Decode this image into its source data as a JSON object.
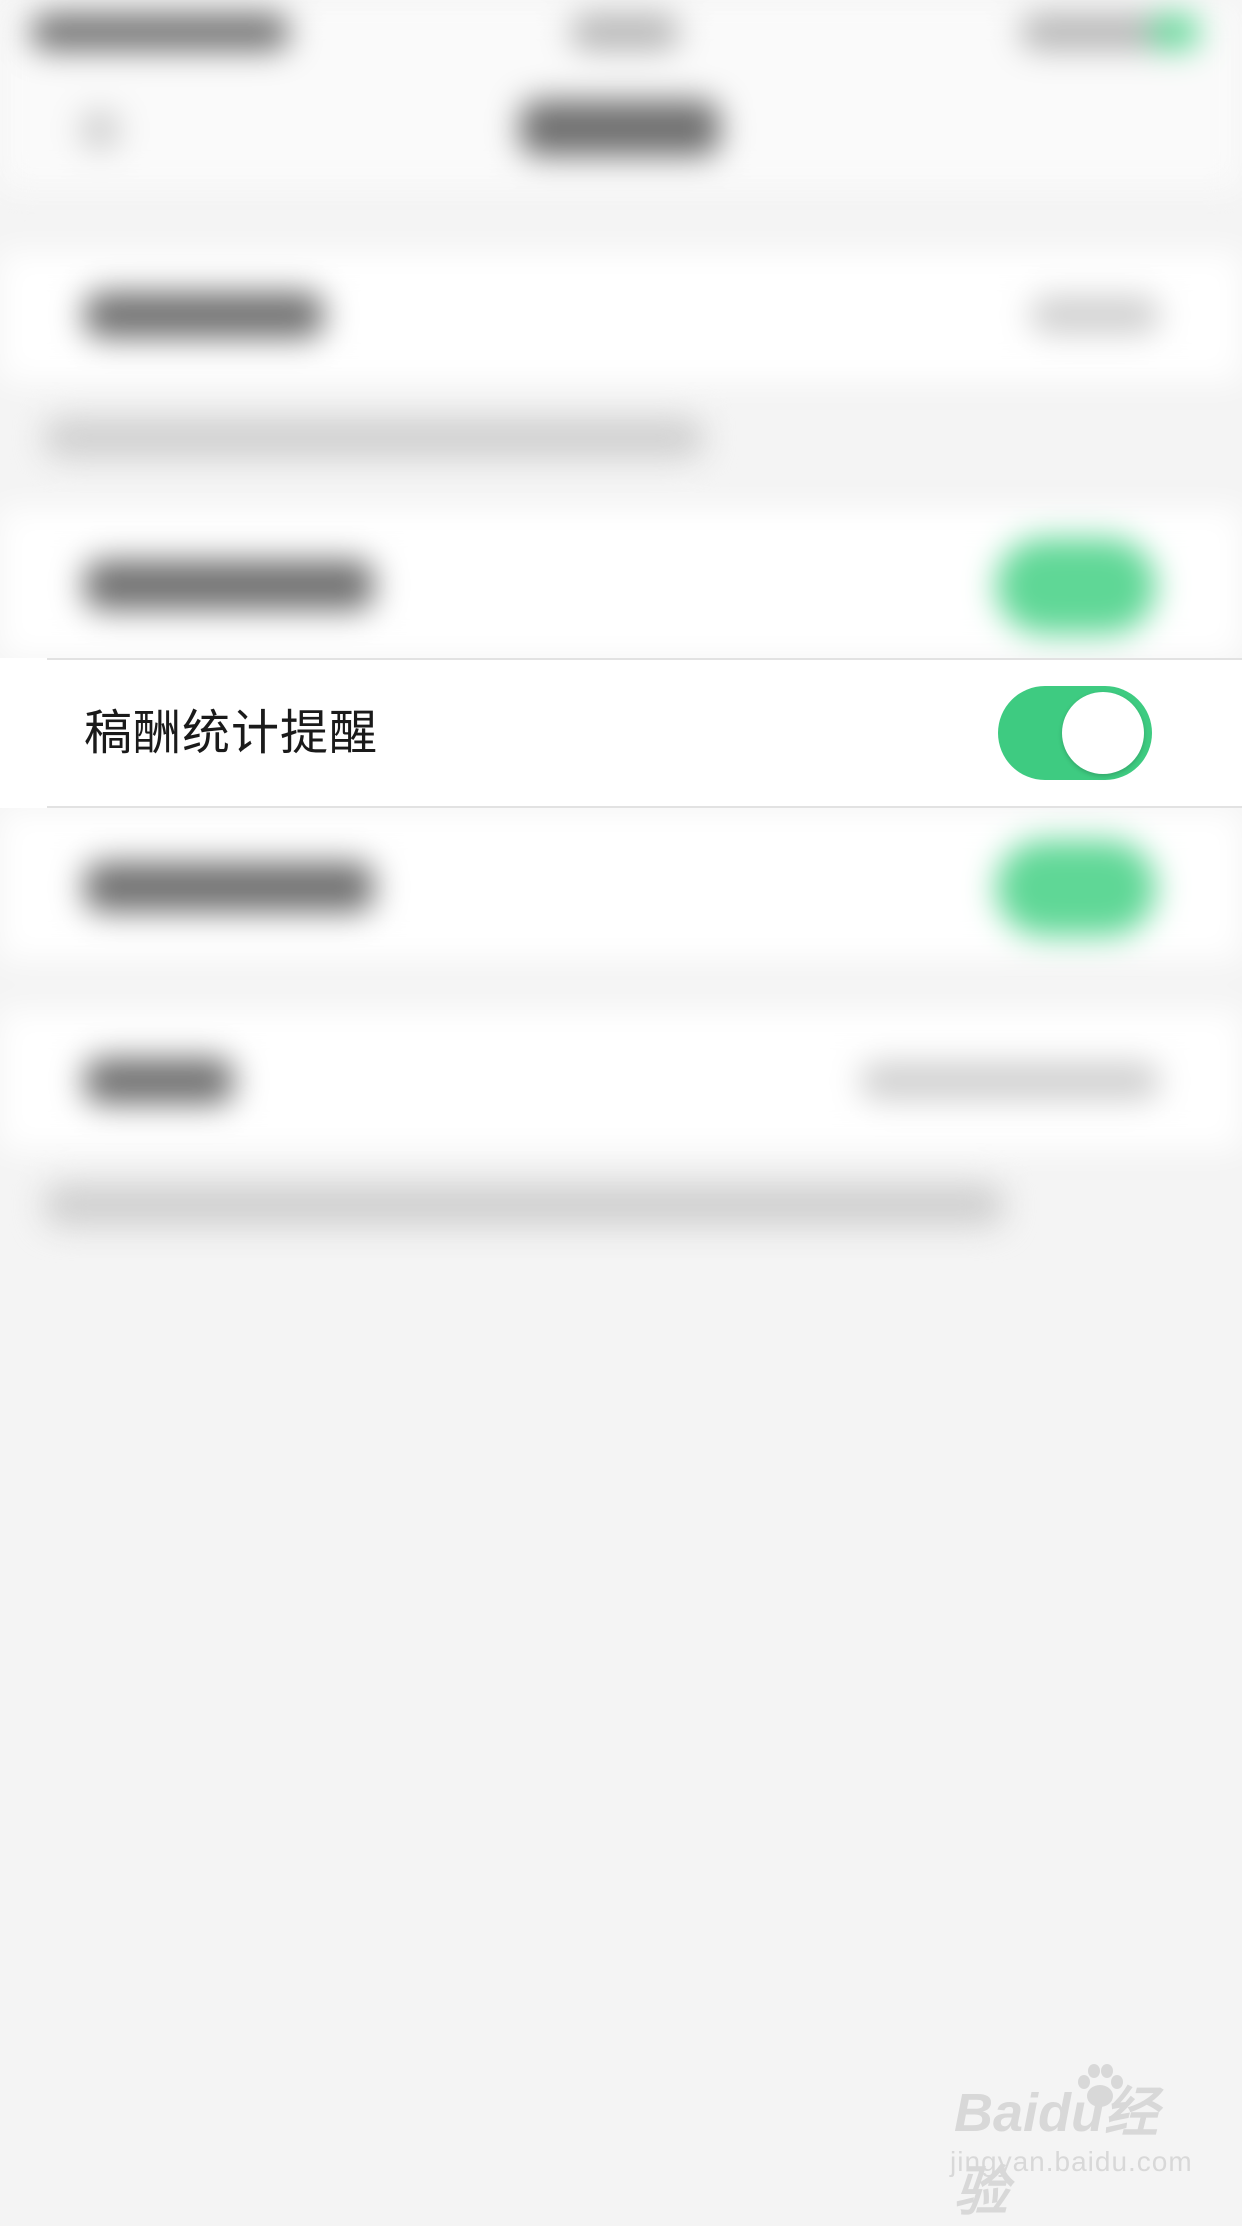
{
  "visible_row": {
    "label": "稿酬统计提醒",
    "toggle_on": true
  },
  "colors": {
    "accent": "#3ecb81",
    "background": "#f4f4f4",
    "row_background": "#ffffff",
    "separator": "#e2e2e2"
  },
  "watermark": {
    "logo": "Baidu经验",
    "url": "jingyan.baidu.com"
  }
}
